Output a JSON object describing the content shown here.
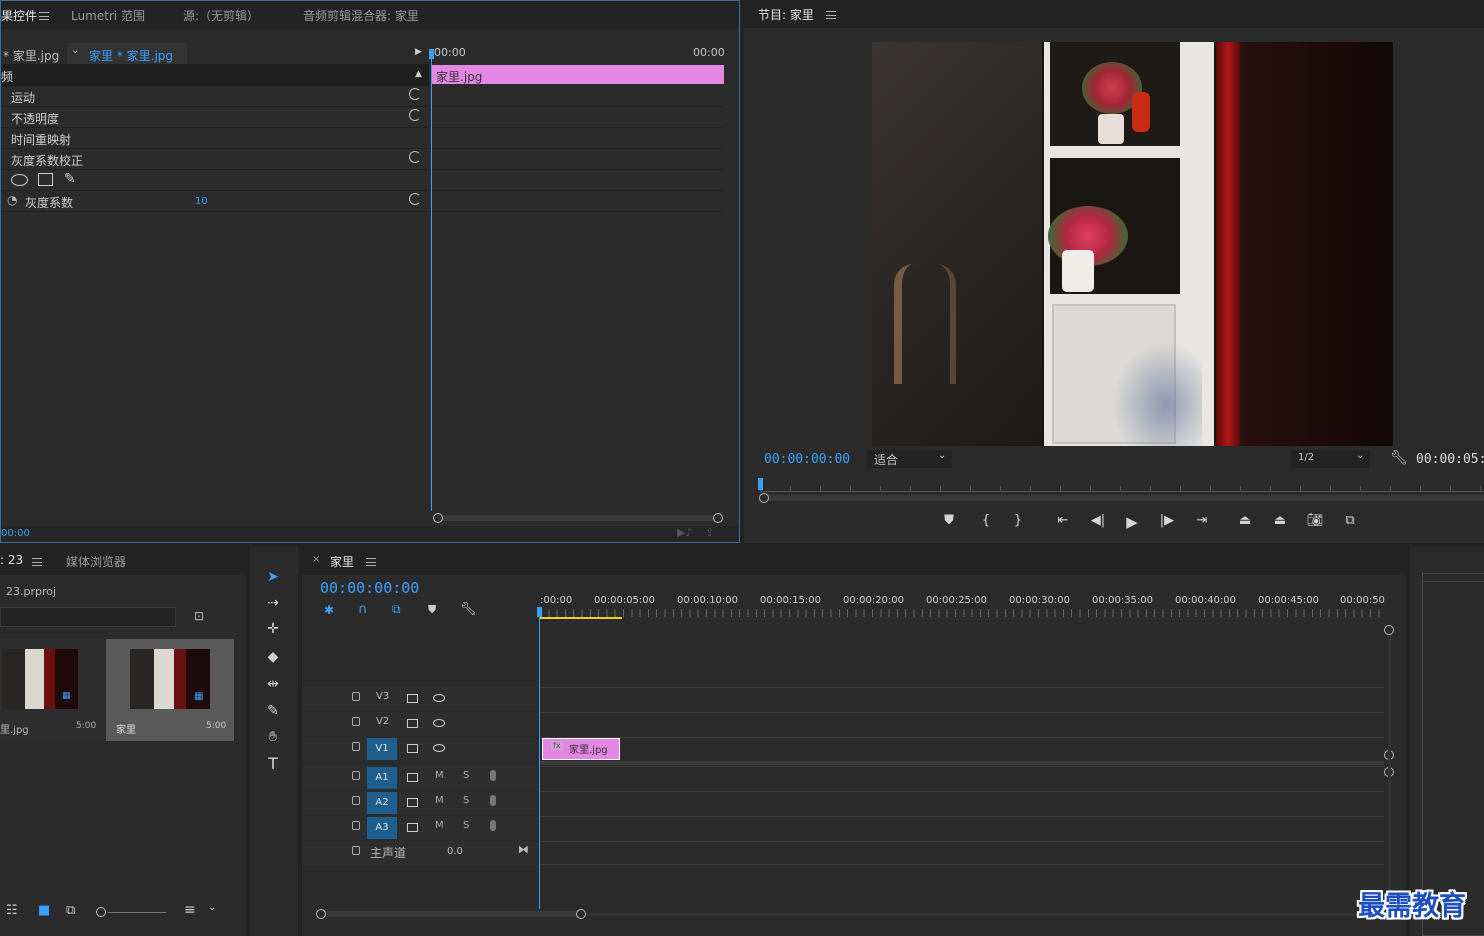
{
  "effects_panel": {
    "tab_title": "果控件",
    "tab_lumetri": "Lumetri 范围",
    "tab_source": "源:（无剪辑）",
    "tab_audio_mixer": "音频剪辑混合器: 家里",
    "clip_master": "* 家里.jpg",
    "clip_sequence": "家里 * 家里.jpg",
    "section_video": "频",
    "effects": [
      {
        "label": "运动"
      },
      {
        "label": "不透明度"
      },
      {
        "label": "时间重映射"
      },
      {
        "label": "灰度系数校正"
      }
    ],
    "param_label": "灰度系数",
    "param_value": "10",
    "timeline_start": "00:00",
    "timeline_end": "00:00",
    "clip_bar_label": "家里.jpg",
    "bottom_time": "00:00",
    "clip_color": "#e486e4"
  },
  "program_monitor": {
    "title": "节目: 家里",
    "timecode": "00:00:00:00",
    "fit_select": "适合",
    "resolution_select": "1/2",
    "duration": "00:00:05:0"
  },
  "project_panel": {
    "tab_title": ": 23",
    "tab_media_browser": "媒体浏览器",
    "project_file": "23.prproj",
    "items": [
      {
        "name": "里.jpg",
        "duration": "5:00"
      },
      {
        "name": "家里",
        "duration": "5:00"
      }
    ]
  },
  "timeline": {
    "tab_title": "家里",
    "timecode": "00:00:00:00",
    "ruler": [
      ":00:00",
      "00:00:05:00",
      "00:00:10:00",
      "00:00:15:00",
      "00:00:20:00",
      "00:00:25:00",
      "00:00:30:00",
      "00:00:35:00",
      "00:00:40:00",
      "00:00:45:00",
      "00:00:50"
    ],
    "video_tracks": [
      "V3",
      "V2",
      "V1"
    ],
    "audio_tracks": [
      "A1",
      "A2",
      "A3"
    ],
    "mute_label": "M",
    "solo_label": "S",
    "master_label": "主声道",
    "master_value": "0.0",
    "clip_label": "家里.jpg",
    "fx_badge": "fx"
  },
  "watermark": "最需教育"
}
